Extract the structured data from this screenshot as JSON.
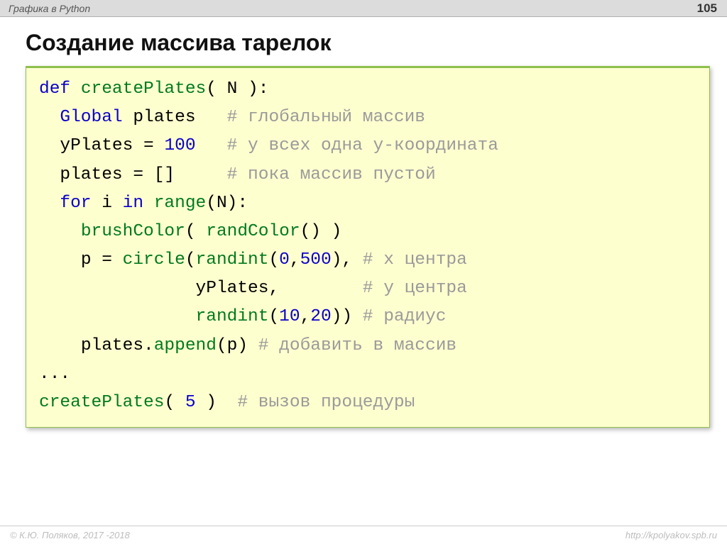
{
  "header": {
    "topic": "Графика в Python",
    "page": "105"
  },
  "title": "Создание массива тарелок",
  "code": {
    "l1": {
      "kw": "def",
      "name": "createPlates",
      "args": "( N ):"
    },
    "l2": {
      "kw": "Global",
      "var": "plates",
      "pad": "   ",
      "cmt": "# глобальный массив"
    },
    "l3": {
      "lhs": "yPlates = ",
      "num": "100",
      "pad": "   ",
      "cmt": "# у всех одна y-координата"
    },
    "l4": {
      "lhs": "plates = []",
      "pad": "     ",
      "cmt": "# пока массив пустой"
    },
    "l5": {
      "kw1": "for",
      "mid": " i ",
      "kw2": "in",
      "fn": " range",
      "rest": "(N):"
    },
    "l6": {
      "fn1": "brushColor",
      "p1": "( ",
      "fn2": "randColor",
      "p2": "() )"
    },
    "l7": {
      "lhs": "p = ",
      "fn": "circle",
      "p1": "(",
      "fn2": "randint",
      "p2": "(",
      "n1": "0",
      "c1": ",",
      "n2": "500",
      "p3": "), ",
      "cmt": "# x центра"
    },
    "l8": {
      "pad": "               ",
      "var": "yPlates,",
      "pad2": "        ",
      "cmt": "# y центра"
    },
    "l9": {
      "pad": "               ",
      "fn": "randint",
      "p1": "(",
      "n1": "10",
      "c1": ",",
      "n2": "20",
      "p2": ")) ",
      "cmt": "# радиус"
    },
    "l10": {
      "var": "plates.",
      "fn": "append",
      "rest": "(p) ",
      "cmt": "# добавить в массив"
    },
    "l11": {
      "txt": "..."
    },
    "l12": {
      "fn": "createPlates",
      "p1": "( ",
      "n": "5",
      "p2": " )  ",
      "cmt": "# вызов процедуры"
    }
  },
  "footer": {
    "copyright": "© К.Ю. Поляков, 2017 -2018",
    "url": "http://kpolyakov.spb.ru"
  }
}
